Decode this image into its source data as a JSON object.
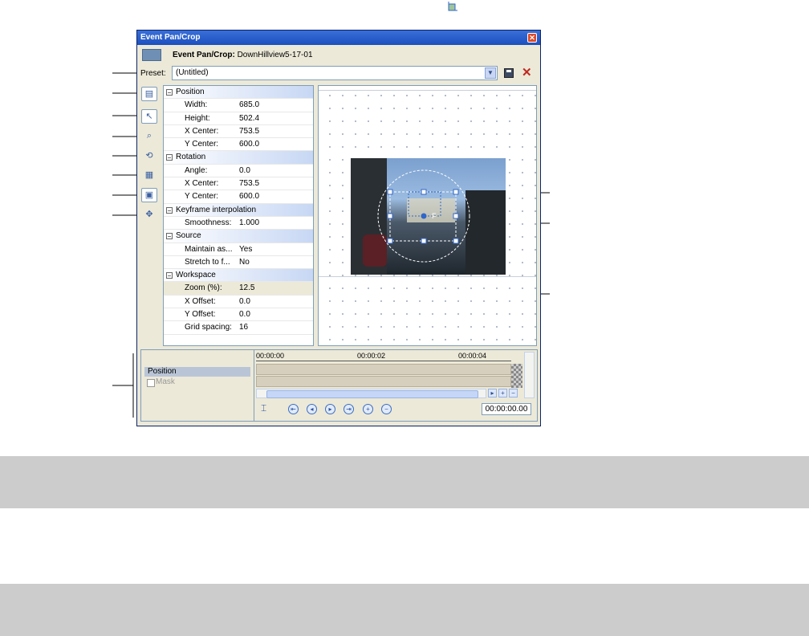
{
  "window": {
    "title": "Event Pan/Crop",
    "close_glyph": "✕",
    "header_label": "Event Pan/Crop:",
    "header_event": "DownHillview5-17-01",
    "header_icon": "event-icon"
  },
  "preset": {
    "label": "Preset:",
    "value": "(Untitled)",
    "save_icon": "save-icon",
    "delete_icon": "delete-icon",
    "delete_glyph": "✕"
  },
  "toolbar": {
    "items": [
      {
        "name": "show-properties-icon",
        "glyph": "▤"
      },
      {
        "name": "normal-edit-tool-icon",
        "glyph": "↖"
      },
      {
        "name": "zoom-tool-icon",
        "glyph": "⌕"
      },
      {
        "name": "enable-rotation-icon",
        "glyph": "⟲"
      },
      {
        "name": "snap-to-grid-icon",
        "glyph": "▦"
      },
      {
        "name": "lock-aspect-ratio-icon",
        "glyph": "▣"
      },
      {
        "name": "scale-about-center-icon",
        "glyph": "⊠"
      },
      {
        "name": "move-freely-icon",
        "glyph": "✥"
      }
    ]
  },
  "properties": {
    "position": {
      "title": "Position",
      "width_label": "Width:",
      "width": "685.0",
      "height_label": "Height:",
      "height": "502.4",
      "xc_label": "X Center:",
      "xc": "753.5",
      "yc_label": "Y Center:",
      "yc": "600.0"
    },
    "rotation": {
      "title": "Rotation",
      "angle_label": "Angle:",
      "angle": "0.0",
      "xc_label": "X Center:",
      "xc": "753.5",
      "yc_label": "Y Center:",
      "yc": "600.0"
    },
    "keyframe": {
      "title": "Keyframe interpolation",
      "smooth_label": "Smoothness:",
      "smooth": "1.000"
    },
    "source": {
      "title": "Source",
      "maintain_label": "Maintain as...",
      "maintain": "Yes",
      "stretch_label": "Stretch to f...",
      "stretch": "No"
    },
    "workspace": {
      "title": "Workspace",
      "zoom_label": "Zoom (%):",
      "zoom": "12.5",
      "xoff_label": "X Offset:",
      "xoff": "0.0",
      "yoff_label": "Y Offset:",
      "yoff": "0.0",
      "grid_label": "Grid spacing:",
      "grid": "16"
    }
  },
  "timeline": {
    "track_position": "Position",
    "track_mask": "Mask",
    "ruler": [
      "00:00:00",
      "00:00:02",
      "00:00:04"
    ],
    "timecode": "00:00:00.00"
  },
  "colors": {
    "titlebar": "#1b4fbf",
    "selection": "#2f66c9",
    "delete": "#c0281e"
  }
}
